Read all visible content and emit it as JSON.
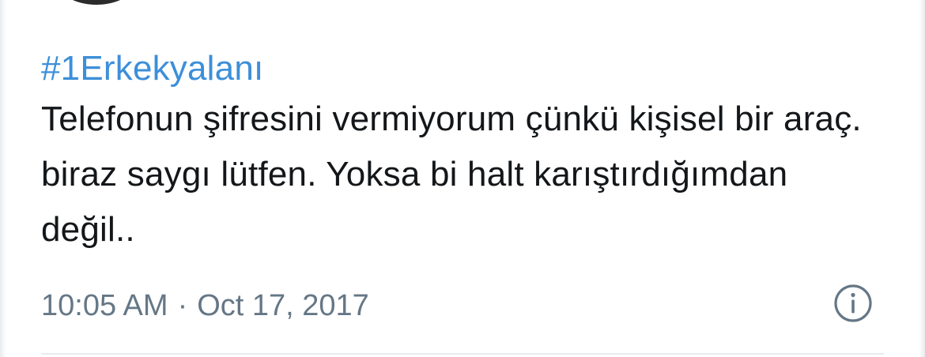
{
  "tweet": {
    "hashtag": "#1Erkekyalanı",
    "text": "Telefonun şifresini vermiyorum çünkü kişisel bir araç. biraz saygı lütfen. Yoksa bi halt karıştırdığımdan değil..",
    "time": "10:05 AM",
    "separator": "·",
    "date": "Oct 17, 2017"
  },
  "icons": {
    "info": "info-icon",
    "avatar": "avatar"
  },
  "colors": {
    "hashtag": "#3d8fd9",
    "text": "#14171a",
    "meta": "#657786"
  }
}
